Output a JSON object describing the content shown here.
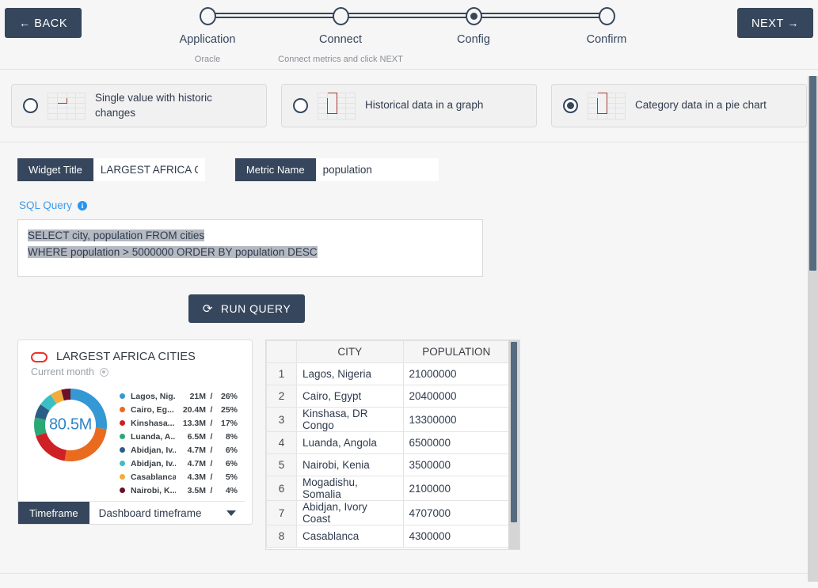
{
  "header": {
    "back_label": "BACK",
    "back_arrow": "←",
    "next_label": "NEXT",
    "next_arrow": "→",
    "steps": [
      {
        "label": "Application",
        "sub": "Oracle",
        "active": false
      },
      {
        "label": "Connect",
        "sub": "Connect metrics and click NEXT",
        "active": false
      },
      {
        "label": "Config",
        "sub": "",
        "active": true
      },
      {
        "label": "Confirm",
        "sub": "",
        "active": false
      }
    ]
  },
  "widget_types": [
    {
      "label": "Single value with historic changes",
      "icon": "grid-single-cell-icon",
      "selected": false
    },
    {
      "label": "Historical data in a graph",
      "icon": "grid-column-icon",
      "selected": false
    },
    {
      "label": "Category data in a pie chart",
      "icon": "grid-column-icon",
      "selected": true
    }
  ],
  "form": {
    "widget_title_label": "Widget Title",
    "widget_title_value": "LARGEST AFRICA CITI",
    "widget_title_placeholder": "Widget Title",
    "metric_name_label": "Metric Name",
    "metric_name_value": "population",
    "metric_name_placeholder": "Metric Name",
    "sql_label": "SQL Query",
    "sql_info_glyph": "i",
    "sql_line1": "SELECT city, population FROM cities",
    "sql_line2": "WHERE population > 5000000 ORDER BY population DESC",
    "run_button_label": "RUN QUERY",
    "run_button_icon": "refresh-icon",
    "run_button_glyph": "⟳"
  },
  "widget_preview": {
    "title": "LARGEST AFRICA CITIES",
    "subtitle": "Current month",
    "center_value": "80.5M",
    "center_color": "#2e86c8",
    "timeframe_label": "Timeframe",
    "timeframe_value": "Dashboard timeframe",
    "separator": "/"
  },
  "chart_data": {
    "type": "pie",
    "title": "LARGEST AFRICA CITIES",
    "subtitle": "Current month",
    "total_label": "80.5M",
    "legend_position": "right",
    "categories": [
      "Lagos, Nig...",
      "Cairo, Eg...",
      "Kinshasa...",
      "Luanda, A...",
      "Abidjan, Iv...",
      "Abidjan, Iv...",
      "Casablanca",
      "Nairobi, K..."
    ],
    "values": [
      21000000,
      20400000,
      13300000,
      6500000,
      4700000,
      4700000,
      4300000,
      3500000
    ],
    "value_labels": [
      "21M",
      "20.4M",
      "13.3M",
      "6.5M",
      "4.7M",
      "4.7M",
      "4.3M",
      "3.5M"
    ],
    "percent_labels": [
      "26%",
      "25%",
      "17%",
      "8%",
      "6%",
      "6%",
      "5%",
      "4%"
    ],
    "percents": [
      26,
      25,
      17,
      8,
      6,
      6,
      5,
      4
    ],
    "colors": [
      "#3498d4",
      "#ea6a1e",
      "#cf2026",
      "#2aa876",
      "#2c5d87",
      "#3bbfc4",
      "#f0ad3e",
      "#6b1026"
    ]
  },
  "result_table": {
    "columns": [
      "",
      "CITY",
      "POPULATION"
    ],
    "rows": [
      {
        "idx": "1",
        "city": "Lagos, Nigeria",
        "population": "21000000"
      },
      {
        "idx": "2",
        "city": "Cairo, Egypt",
        "population": "20400000"
      },
      {
        "idx": "3",
        "city": "Kinshasa, DR Congo",
        "population": "13300000"
      },
      {
        "idx": "4",
        "city": "Luanda, Angola",
        "population": "6500000"
      },
      {
        "idx": "5",
        "city": "Nairobi, Kenia",
        "population": "3500000"
      },
      {
        "idx": "6",
        "city": "Mogadishu, Somalia",
        "population": "2100000"
      },
      {
        "idx": "7",
        "city": "Abidjan, Ivory Coast",
        "population": "4707000"
      },
      {
        "idx": "8",
        "city": "Casablanca",
        "population": "4300000"
      }
    ]
  }
}
